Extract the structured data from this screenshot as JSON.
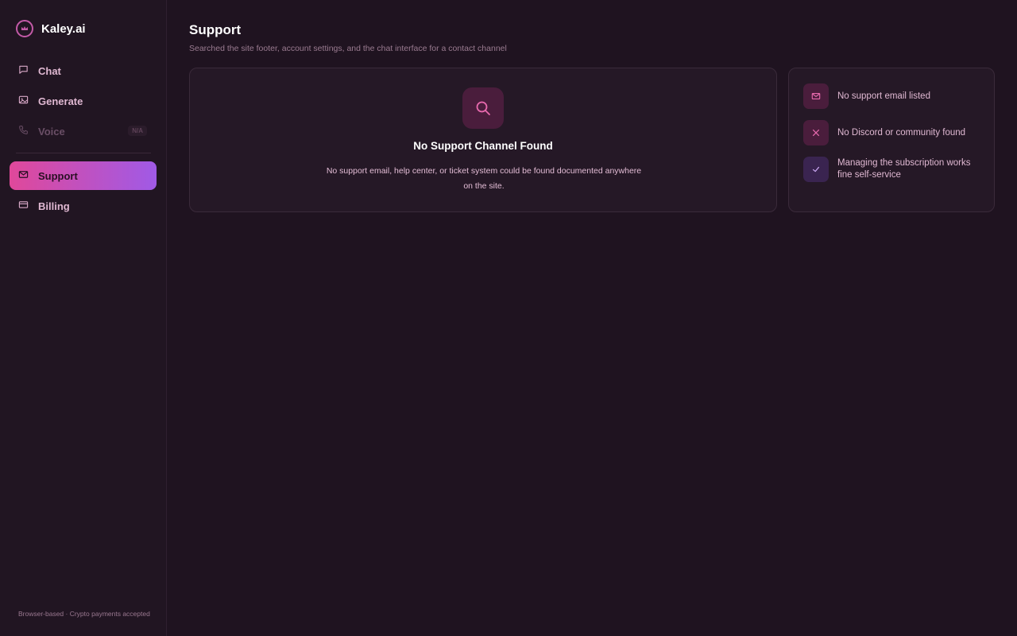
{
  "brand": {
    "name": "Kaley.ai",
    "icon": "crown-logo-icon"
  },
  "sidebar": {
    "items": [
      {
        "label": "Chat",
        "icon": "chat-bubble-icon",
        "state": "normal"
      },
      {
        "label": "Generate",
        "icon": "image-icon",
        "state": "normal"
      },
      {
        "label": "Voice",
        "icon": "phone-icon",
        "state": "disabled",
        "badge": "N/A"
      },
      {
        "label": "Support",
        "icon": "mail-icon",
        "state": "active"
      },
      {
        "label": "Billing",
        "icon": "credit-card-icon",
        "state": "normal"
      }
    ],
    "footer": "Browser-based · Crypto payments accepted"
  },
  "page": {
    "title": "Support",
    "subtitle": "Searched the site footer, account settings, and the chat interface for a contact channel"
  },
  "main_card": {
    "icon": "search-icon",
    "heading": "No Support Channel Found",
    "description": "No support email, help center, or ticket system could be found documented anywhere on the site."
  },
  "side_card": {
    "rows": [
      {
        "icon": "mail-icon",
        "text": "No support email listed",
        "tone": "pink"
      },
      {
        "icon": "close-icon",
        "text": "No Discord or community found",
        "tone": "pink"
      },
      {
        "icon": "check-icon",
        "text": "Managing the subscription works fine self-service",
        "tone": "purple"
      }
    ]
  },
  "colors": {
    "background": "#1f1320",
    "accent_start": "#e0489a",
    "accent_end": "#a05ae6",
    "icon_pink": "#e86aae",
    "icon_purple": "#c9a6f0"
  }
}
